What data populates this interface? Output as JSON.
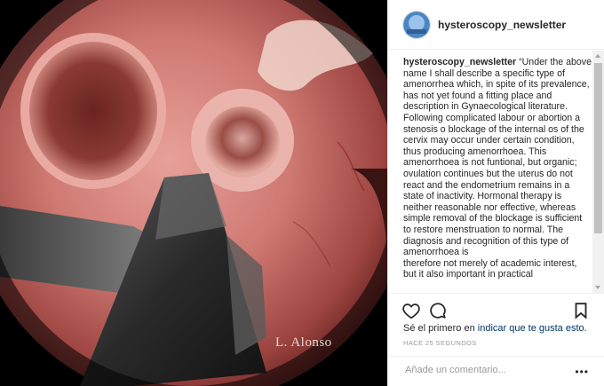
{
  "post": {
    "image_description": "",
    "watermark": "L. Alonso"
  },
  "header": {
    "username": "hysteroscopy_newsletter"
  },
  "caption": {
    "username": "hysteroscopy_newsletter",
    "text": " “Under the above name I shall describe a specific type of amenorrhea which, in spite of its prevalence, has not yet found a fitting place and description in Gynaecological literature. Following complicated labour or abortion a stenosis o blockage of the internal os of the cervix may occur under certain condition, thus producing amenorrhoea. This amenorrhoea is not funtional, but organic; ovulation continues but the uterus do not react and the endometrium remains in a state of inactivity. Hormonal therapy is neither reasonable nor effective, whereas simple removal of the blockage is sufficient to restore menstruation to normal. The diagnosis and recognition of this type of amenorrhoea is",
    "text2": "therefore not merely of academic interest, but it also important in practical"
  },
  "likes": {
    "prefix": "Sé el primero en ",
    "link": "indicar que te gusta esto",
    "suffix": "."
  },
  "timestamp": "HACE 25 SEGUNDOS",
  "comment": {
    "placeholder": "Añade un comentario...",
    "more": "•••"
  },
  "icons": {
    "like": "heart-icon",
    "comment": "comment-icon",
    "save": "bookmark-icon"
  }
}
